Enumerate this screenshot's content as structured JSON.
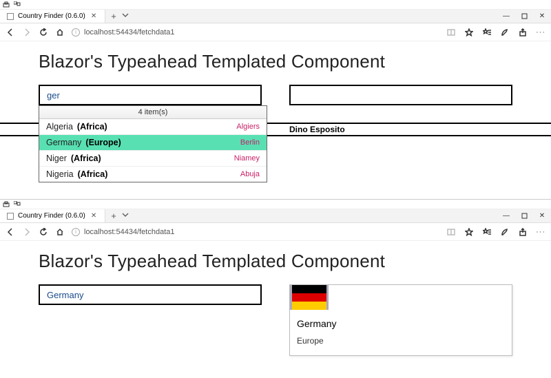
{
  "tab_title": "Country Finder (0.6.0)",
  "url_text": "localhost:54434/fetchdata1",
  "heading": "Blazor's Typeahead Templated Component",
  "top": {
    "input_value": "ger",
    "dd_header": "4 item(s)",
    "items": [
      {
        "country": "Algeria",
        "continent": "(Africa)",
        "capital": "Algiers",
        "selected": false
      },
      {
        "country": "Germany",
        "continent": "(Europe)",
        "capital": "Berlin",
        "selected": true
      },
      {
        "country": "Niger",
        "continent": "(Africa)",
        "capital": "Niamey",
        "selected": false
      },
      {
        "country": "Nigeria",
        "continent": "(Africa)",
        "capital": "Abuja",
        "selected": false
      }
    ],
    "author": "Dino Esposito"
  },
  "bottom": {
    "input_value": "Germany",
    "card_title": "Germany",
    "card_sub": "Europe"
  }
}
